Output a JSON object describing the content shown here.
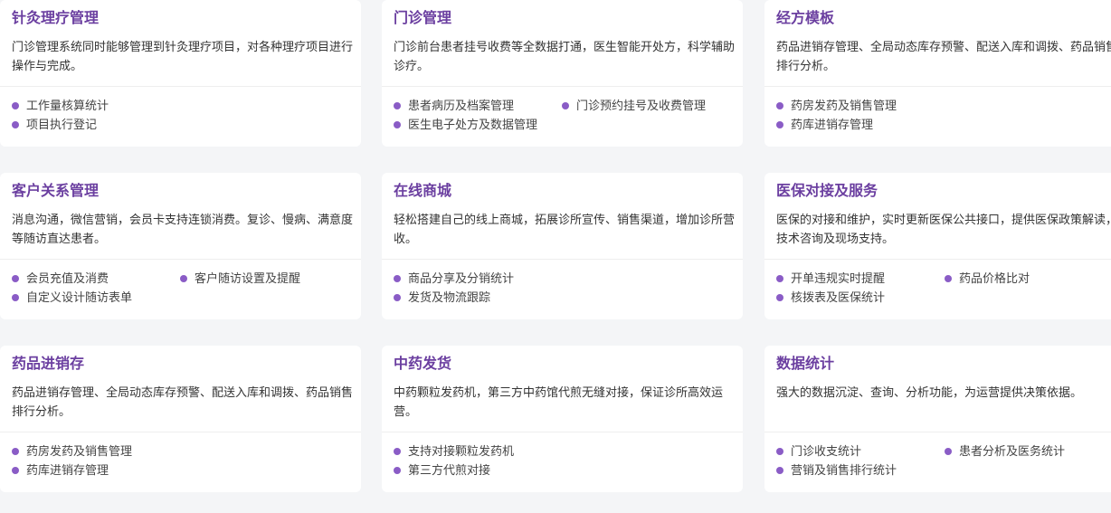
{
  "cards": [
    {
      "title": "针灸理疗管理",
      "desc": "门诊管理系统同时能够管理到针灸理疗项目，对各种理疗项目进行操作与完成。",
      "features": [
        "工作量核算统计",
        "项目执行登记"
      ]
    },
    {
      "title": "门诊管理",
      "desc": "门诊前台患者挂号收费等全数据打通，医生智能开处方，科学辅助诊疗。",
      "features": [
        "患者病历及档案管理",
        "门诊预约挂号及收费管理",
        "医生电子处方及数据管理"
      ]
    },
    {
      "title": "经方模板",
      "desc": "药品进销存管理、全局动态库存预警、配送入库和调拨、药品销售排行分析。",
      "features": [
        "药房发药及销售管理",
        "药库进销存管理"
      ]
    },
    {
      "title": "客户关系管理",
      "desc": "消息沟通，微信营销，会员卡支持连锁消费。复诊、慢病、满意度等随访直达患者。",
      "features": [
        "会员充值及消费",
        "客户随访设置及提醒",
        "自定义设计随访表单"
      ]
    },
    {
      "title": "在线商城",
      "desc": "轻松搭建自己的线上商城，拓展诊所宣传、销售渠道，增加诊所营收。",
      "features": [
        "商品分享及分销统计",
        "发货及物流跟踪"
      ]
    },
    {
      "title": "医保对接及服务",
      "desc": "医保的对接和维护，实时更新医保公共接口，提供医保政策解读，技术咨询及现场支持。",
      "features": [
        "开单违规实时提醒",
        "药品价格比对",
        "核拨表及医保统计"
      ]
    },
    {
      "title": "药品进销存",
      "desc": "药品进销存管理、全局动态库存预警、配送入库和调拨、药品销售排行分析。",
      "features": [
        "药房发药及销售管理",
        "药库进销存管理"
      ]
    },
    {
      "title": "中药发货",
      "desc": "中药颗粒发药机，第三方中药馆代煎无缝对接，保证诊所高效运营。",
      "features": [
        "支持对接颗粒发药机",
        "第三方代煎对接"
      ]
    },
    {
      "title": "数据统计",
      "desc": "强大的数据沉淀、查询、分析功能，为运营提供决策依据。",
      "features": [
        "门诊收支统计",
        "患者分析及医务统计",
        "营销及销售排行统计"
      ]
    }
  ]
}
